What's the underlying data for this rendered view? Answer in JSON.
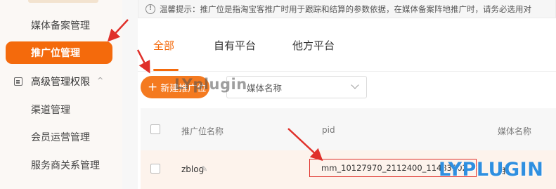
{
  "sidebar": {
    "items": [
      {
        "label": "媒体备案管理"
      },
      {
        "label": "推广位管理",
        "active": true
      }
    ],
    "group": {
      "label": "高级管理权限",
      "chevron": "^"
    },
    "group_items": [
      {
        "label": "渠道管理"
      },
      {
        "label": "会员运营管理"
      },
      {
        "label": "服务商关系管理"
      }
    ]
  },
  "notice": {
    "icon": "!",
    "text": "温馨提示：推广位是指淘宝客推广时用于跟踪和结算的参数依据，在媒体备案阵地推广时，请务必选用对"
  },
  "tabs": [
    {
      "label": "全部",
      "active": true
    },
    {
      "label": "自有平台"
    },
    {
      "label": "他方平台"
    }
  ],
  "toolbar": {
    "add_icon": "+",
    "add_label": "新建推广位",
    "select_value": "媒体名称"
  },
  "table": {
    "columns": [
      "推广位名称",
      "pid",
      "媒体名称"
    ],
    "rows": [
      {
        "name": "zblog",
        "pid": "mm_10127970_2112400_11483102",
        "media": "自"
      }
    ]
  },
  "watermarks": {
    "center": "LYplugin",
    "logo": "LYPLUGIN"
  },
  "colors": {
    "accent": "#f46a0c",
    "highlight_border": "#e0302a",
    "arrow": "#e0302a",
    "logo": "#2f8fe0"
  }
}
